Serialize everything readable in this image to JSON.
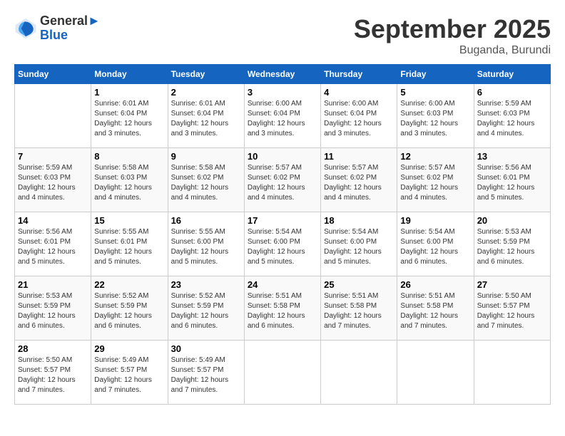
{
  "header": {
    "logo_line1": "General",
    "logo_line2": "Blue",
    "month": "September 2025",
    "location": "Buganda, Burundi"
  },
  "weekdays": [
    "Sunday",
    "Monday",
    "Tuesday",
    "Wednesday",
    "Thursday",
    "Friday",
    "Saturday"
  ],
  "weeks": [
    [
      {
        "day": "",
        "info": ""
      },
      {
        "day": "1",
        "info": "Sunrise: 6:01 AM\nSunset: 6:04 PM\nDaylight: 12 hours\nand 3 minutes."
      },
      {
        "day": "2",
        "info": "Sunrise: 6:01 AM\nSunset: 6:04 PM\nDaylight: 12 hours\nand 3 minutes."
      },
      {
        "day": "3",
        "info": "Sunrise: 6:00 AM\nSunset: 6:04 PM\nDaylight: 12 hours\nand 3 minutes."
      },
      {
        "day": "4",
        "info": "Sunrise: 6:00 AM\nSunset: 6:04 PM\nDaylight: 12 hours\nand 3 minutes."
      },
      {
        "day": "5",
        "info": "Sunrise: 6:00 AM\nSunset: 6:03 PM\nDaylight: 12 hours\nand 3 minutes."
      },
      {
        "day": "6",
        "info": "Sunrise: 5:59 AM\nSunset: 6:03 PM\nDaylight: 12 hours\nand 4 minutes."
      }
    ],
    [
      {
        "day": "7",
        "info": "Sunrise: 5:59 AM\nSunset: 6:03 PM\nDaylight: 12 hours\nand 4 minutes."
      },
      {
        "day": "8",
        "info": "Sunrise: 5:58 AM\nSunset: 6:03 PM\nDaylight: 12 hours\nand 4 minutes."
      },
      {
        "day": "9",
        "info": "Sunrise: 5:58 AM\nSunset: 6:02 PM\nDaylight: 12 hours\nand 4 minutes."
      },
      {
        "day": "10",
        "info": "Sunrise: 5:57 AM\nSunset: 6:02 PM\nDaylight: 12 hours\nand 4 minutes."
      },
      {
        "day": "11",
        "info": "Sunrise: 5:57 AM\nSunset: 6:02 PM\nDaylight: 12 hours\nand 4 minutes."
      },
      {
        "day": "12",
        "info": "Sunrise: 5:57 AM\nSunset: 6:02 PM\nDaylight: 12 hours\nand 4 minutes."
      },
      {
        "day": "13",
        "info": "Sunrise: 5:56 AM\nSunset: 6:01 PM\nDaylight: 12 hours\nand 5 minutes."
      }
    ],
    [
      {
        "day": "14",
        "info": "Sunrise: 5:56 AM\nSunset: 6:01 PM\nDaylight: 12 hours\nand 5 minutes."
      },
      {
        "day": "15",
        "info": "Sunrise: 5:55 AM\nSunset: 6:01 PM\nDaylight: 12 hours\nand 5 minutes."
      },
      {
        "day": "16",
        "info": "Sunrise: 5:55 AM\nSunset: 6:00 PM\nDaylight: 12 hours\nand 5 minutes."
      },
      {
        "day": "17",
        "info": "Sunrise: 5:54 AM\nSunset: 6:00 PM\nDaylight: 12 hours\nand 5 minutes."
      },
      {
        "day": "18",
        "info": "Sunrise: 5:54 AM\nSunset: 6:00 PM\nDaylight: 12 hours\nand 5 minutes."
      },
      {
        "day": "19",
        "info": "Sunrise: 5:54 AM\nSunset: 6:00 PM\nDaylight: 12 hours\nand 6 minutes."
      },
      {
        "day": "20",
        "info": "Sunrise: 5:53 AM\nSunset: 5:59 PM\nDaylight: 12 hours\nand 6 minutes."
      }
    ],
    [
      {
        "day": "21",
        "info": "Sunrise: 5:53 AM\nSunset: 5:59 PM\nDaylight: 12 hours\nand 6 minutes."
      },
      {
        "day": "22",
        "info": "Sunrise: 5:52 AM\nSunset: 5:59 PM\nDaylight: 12 hours\nand 6 minutes."
      },
      {
        "day": "23",
        "info": "Sunrise: 5:52 AM\nSunset: 5:59 PM\nDaylight: 12 hours\nand 6 minutes."
      },
      {
        "day": "24",
        "info": "Sunrise: 5:51 AM\nSunset: 5:58 PM\nDaylight: 12 hours\nand 6 minutes."
      },
      {
        "day": "25",
        "info": "Sunrise: 5:51 AM\nSunset: 5:58 PM\nDaylight: 12 hours\nand 7 minutes."
      },
      {
        "day": "26",
        "info": "Sunrise: 5:51 AM\nSunset: 5:58 PM\nDaylight: 12 hours\nand 7 minutes."
      },
      {
        "day": "27",
        "info": "Sunrise: 5:50 AM\nSunset: 5:57 PM\nDaylight: 12 hours\nand 7 minutes."
      }
    ],
    [
      {
        "day": "28",
        "info": "Sunrise: 5:50 AM\nSunset: 5:57 PM\nDaylight: 12 hours\nand 7 minutes."
      },
      {
        "day": "29",
        "info": "Sunrise: 5:49 AM\nSunset: 5:57 PM\nDaylight: 12 hours\nand 7 minutes."
      },
      {
        "day": "30",
        "info": "Sunrise: 5:49 AM\nSunset: 5:57 PM\nDaylight: 12 hours\nand 7 minutes."
      },
      {
        "day": "",
        "info": ""
      },
      {
        "day": "",
        "info": ""
      },
      {
        "day": "",
        "info": ""
      },
      {
        "day": "",
        "info": ""
      }
    ]
  ]
}
